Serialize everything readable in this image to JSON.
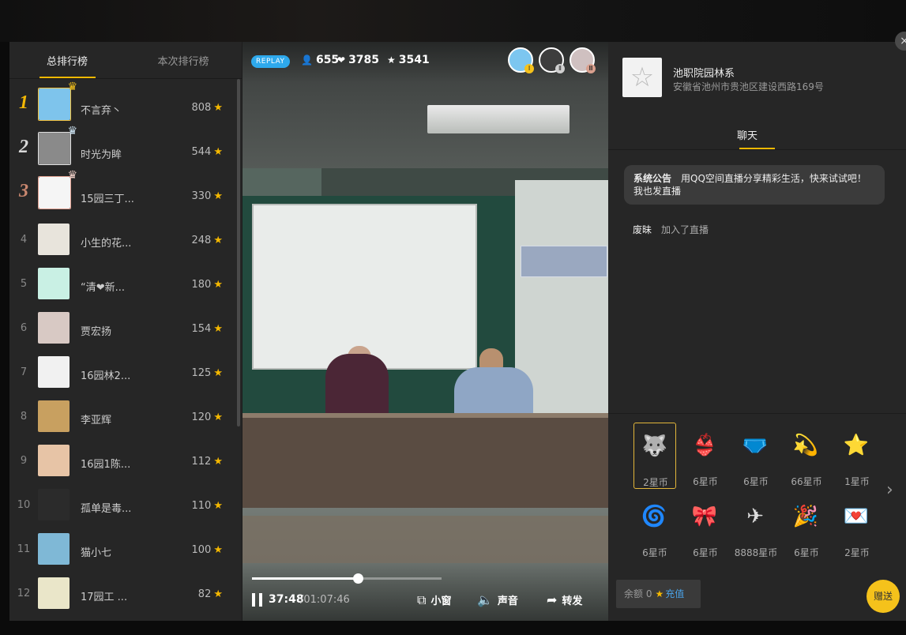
{
  "ranking": {
    "tabs": [
      "总排行榜",
      "本次排行榜"
    ],
    "active_tab": 0,
    "rows": [
      {
        "rank": "1",
        "name": "不言弃丶",
        "score": "808",
        "avatar_color": "#7ec4ec",
        "crown": "♛"
      },
      {
        "rank": "2",
        "name": "时光为眸",
        "score": "544",
        "avatar_color": "#8a8a8a",
        "crown": "♛"
      },
      {
        "rank": "3",
        "name": "15园三丁...",
        "score": "330",
        "avatar_color": "#f5f5f5",
        "crown": "♛"
      },
      {
        "rank": "4",
        "name": "小生的花...",
        "score": "248",
        "avatar_color": "#e8e4dc"
      },
      {
        "rank": "5",
        "name": "“清❤新...",
        "score": "180",
        "avatar_color": "#c9f0e4"
      },
      {
        "rank": "6",
        "name": "贾宏扬",
        "score": "154",
        "avatar_color": "#d8c9c4"
      },
      {
        "rank": "7",
        "name": "16园林2...",
        "score": "125",
        "avatar_color": "#f1f1f1"
      },
      {
        "rank": "8",
        "name": "李亚辉",
        "score": "120",
        "avatar_color": "#c8a060"
      },
      {
        "rank": "9",
        "name": "16园1陈...",
        "score": "112",
        "avatar_color": "#e7c4a6"
      },
      {
        "rank": "10",
        "name": "孤单是毒...",
        "score": "110",
        "avatar_color": "#2b2b2b"
      },
      {
        "rank": "11",
        "name": "猫小七",
        "score": "100",
        "avatar_color": "#7fb8d6"
      },
      {
        "rank": "12",
        "name": "17园工 ...",
        "score": "82",
        "avatar_color": "#eae6c9"
      }
    ]
  },
  "video": {
    "badge": "REPLAY",
    "viewers": "655",
    "likes": "3785",
    "stars": "3541",
    "top_viewers": [
      {
        "color": "#7cc6f0",
        "badge": "Ⅰ",
        "badge_color": "#f5c21b"
      },
      {
        "color": "#3d3d3d",
        "badge": "Ⅱ",
        "badge_color": "#d0d0d0"
      },
      {
        "color": "#cfc0c0",
        "badge": "Ⅲ",
        "badge_color": "#d9a08e"
      }
    ],
    "playback": {
      "current": "37:48",
      "total": "/01:07:46",
      "progress_fraction": 0.558
    },
    "controls": {
      "mini": "小窗",
      "sound": "声音",
      "share": "转发"
    }
  },
  "room": {
    "title": "池职院园林系",
    "address": "安徽省池州市贵池区建设西路169号",
    "logo_glyph": "☆"
  },
  "chat": {
    "tab": "聊天",
    "notice_title": "系统公告",
    "notice_text": "用QQ空间直播分享精彩生活，快来试试吧！我也发直播",
    "messages": [
      {
        "user": "废昧",
        "text": "加入了直播"
      }
    ]
  },
  "gifts": [
    {
      "icon": "🐺",
      "price": "2星币",
      "selected": true
    },
    {
      "icon": "👙",
      "price": "6星币"
    },
    {
      "icon": "🩲",
      "price": "6星币"
    },
    {
      "icon": "💫",
      "price": "66星币"
    },
    {
      "icon": "⭐",
      "price": "1星币"
    },
    {
      "icon": "🌀",
      "price": "6星币"
    },
    {
      "icon": "🎀",
      "price": "6星币"
    },
    {
      "icon": "✈",
      "price": "8888星币"
    },
    {
      "icon": "🎉",
      "price": "6星币"
    },
    {
      "icon": "💌",
      "price": "2星币"
    }
  ],
  "wallet": {
    "balance_label": "余额",
    "balance_value": "0",
    "recharge": "充值",
    "send": "赠送"
  },
  "icons": {
    "close": "×",
    "next": "›",
    "user": "👤",
    "heart": "❤",
    "star": "★"
  }
}
